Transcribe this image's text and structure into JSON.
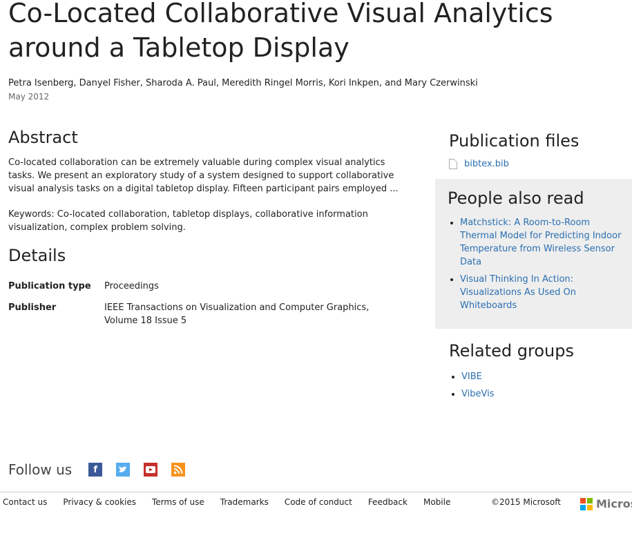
{
  "title": "Co-Located Collaborative Visual Analytics around a Tabletop Display",
  "authors": "Petra Isenberg, Danyel Fisher, Sharoda A. Paul, Meredith Ringel Morris, Kori Inkpen, and Mary Czerwinski",
  "date": "May 2012",
  "abstract": {
    "heading": "Abstract",
    "text": "Co-located collaboration can be extremely valuable during complex visual analytics tasks. We present an exploratory study of a system designed to support collaborative visual analysis tasks on a digital tabletop display. Fifteen participant pairs employed ...",
    "keywords": "Keywords: Co-located collaboration, tabletop displays, collaborative information visualization, complex problem solving."
  },
  "details": {
    "heading": "Details",
    "rows": [
      {
        "key": "Publication type",
        "value": "Proceedings"
      },
      {
        "key": "Publisher",
        "value": "IEEE Transactions on Visualization and Computer Graphics, Volume 18 Issue 5"
      }
    ]
  },
  "files": {
    "heading": "Publication files",
    "items": [
      "bibtex.bib"
    ]
  },
  "people": {
    "heading": "People also read",
    "items": [
      "Matchstick: A Room-to-Room Thermal Model for Predicting Indoor Temperature from Wireless Sensor Data",
      "Visual Thinking In Action: Visualizations As Used On Whiteboards"
    ]
  },
  "groups": {
    "heading": "Related groups",
    "items": [
      "VIBE",
      "VibeVis"
    ]
  },
  "follow": {
    "label": "Follow us",
    "icons": [
      "facebook-icon",
      "twitter-icon",
      "youtube-icon",
      "rss-icon"
    ]
  },
  "footer": {
    "links": [
      "Contact us",
      "Privacy & cookies",
      "Terms of use",
      "Trademarks",
      "Code of conduct",
      "Feedback",
      "Mobile"
    ],
    "copyright": "©2015 Microsoft",
    "brand": "Microsoft"
  }
}
